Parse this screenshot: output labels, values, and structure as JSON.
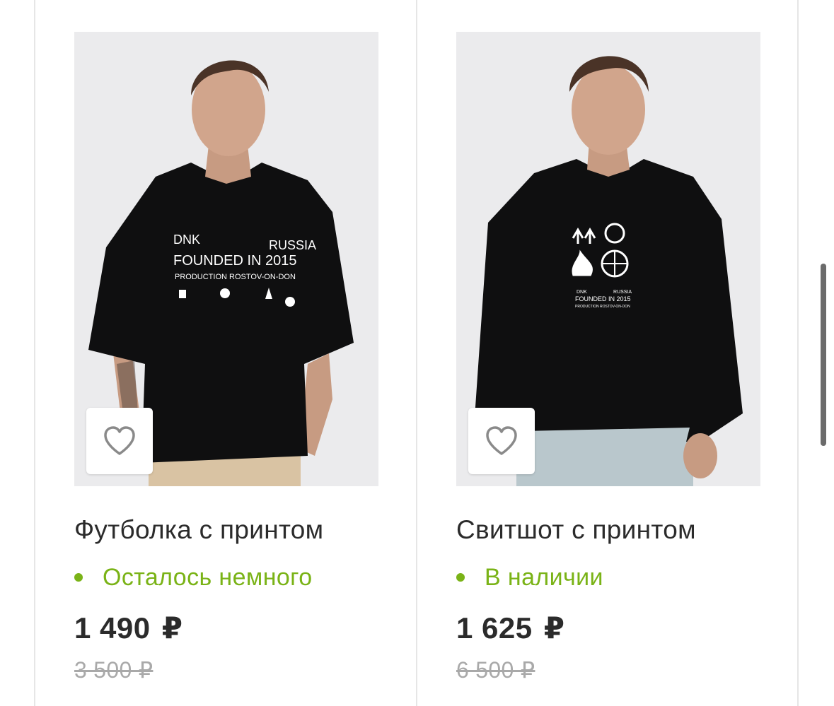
{
  "colors": {
    "accent_green": "#7ab317",
    "text_dark": "#2b2b2b",
    "old_price_grey": "#a9a9a9",
    "photo_bg": "#ebebed"
  },
  "products": [
    {
      "title": "Футболка с принтом",
      "stock_status": "Осталось немного",
      "price": "1 490",
      "currency": "₽",
      "old_price": "3 500 ₽",
      "favorite_icon": "heart-outline-icon",
      "photo_print": {
        "line1_left": "DNK",
        "line1_right": "RUSSIA",
        "line2": "FOUNDED IN 2015",
        "line3": "PRODUCTION ROSTOV-ON-DON"
      }
    },
    {
      "title": "Свитшот с принтом",
      "stock_status": "В наличии",
      "price": "1 625",
      "currency": "₽",
      "old_price": "6 500 ₽",
      "favorite_icon": "heart-outline-icon",
      "photo_print": {
        "line1_left": "DNK",
        "line1_right": "RUSSIA",
        "line2": "FOUNDED IN 2015",
        "line3": "PRODUCTION ROSTOV-ON-DON"
      }
    }
  ]
}
